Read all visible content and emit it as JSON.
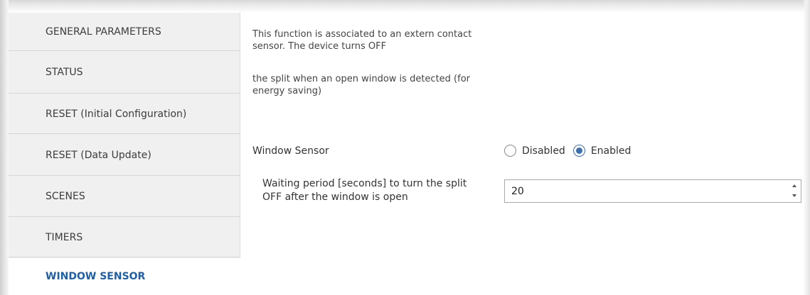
{
  "sidebar": {
    "items": [
      {
        "label": "GENERAL PARAMETERS"
      },
      {
        "label": "STATUS"
      },
      {
        "label": "RESET (Initial Configuration)"
      },
      {
        "label": "RESET (Data Update)"
      },
      {
        "label": "SCENES"
      },
      {
        "label": "TIMERS"
      },
      {
        "label": "WINDOW SENSOR"
      }
    ],
    "active_index": 6,
    "active_color": "#1f5fa6"
  },
  "main": {
    "description_1": "This function is associated to an extern contact sensor. The device turns OFF",
    "description_2": "the split when an open window is detected (for energy saving)",
    "window_sensor": {
      "label": "Window Sensor",
      "options": [
        {
          "label": "Disabled",
          "checked": false
        },
        {
          "label": "Enabled",
          "checked": true
        }
      ]
    },
    "waiting_period": {
      "label": "Waiting period [seconds] to turn the split OFF after the window is open",
      "value": "20"
    }
  },
  "icons": {
    "spin_up": "chevron-up-icon",
    "spin_down": "chevron-down-icon"
  }
}
